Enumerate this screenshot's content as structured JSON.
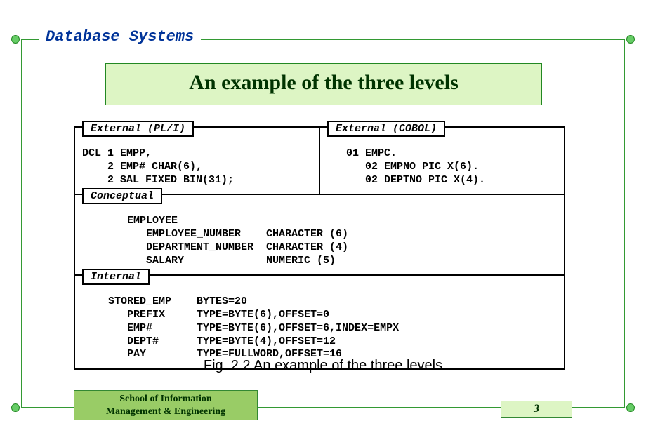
{
  "header": "Database Systems",
  "title": "An example of the three levels",
  "levels": {
    "external_pl1": {
      "label": "External (PL/I)",
      "code": "DCL 1 EMPP,\n    2 EMP# CHAR(6),\n    2 SAL FIXED BIN(31);"
    },
    "external_cobol": {
      "label": "External (COBOL)",
      "code": "   01 EMPC.\n      02 EMPNO PIC X(6).\n      02 DEPTNO PIC X(4)."
    },
    "conceptual": {
      "label": "Conceptual",
      "code": "      EMPLOYEE\n         EMPLOYEE_NUMBER    CHARACTER (6)\n         DEPARTMENT_NUMBER  CHARACTER (4)\n         SALARY             NUMERIC (5)"
    },
    "internal": {
      "label": "Internal",
      "code": "   STORED_EMP    BYTES=20\n      PREFIX     TYPE=BYTE(6),OFFSET=0\n      EMP#       TYPE=BYTE(6),OFFSET=6,INDEX=EMPX\n      DEPT#      TYPE=BYTE(4),OFFSET=12\n      PAY        TYPE=FULLWORD,OFFSET=16"
    }
  },
  "caption": "Fig. 2.2 An example of the three levels",
  "footer": {
    "school_line1": "School of Information",
    "school_line2": "Management & Engineering",
    "pagenum": "3"
  }
}
